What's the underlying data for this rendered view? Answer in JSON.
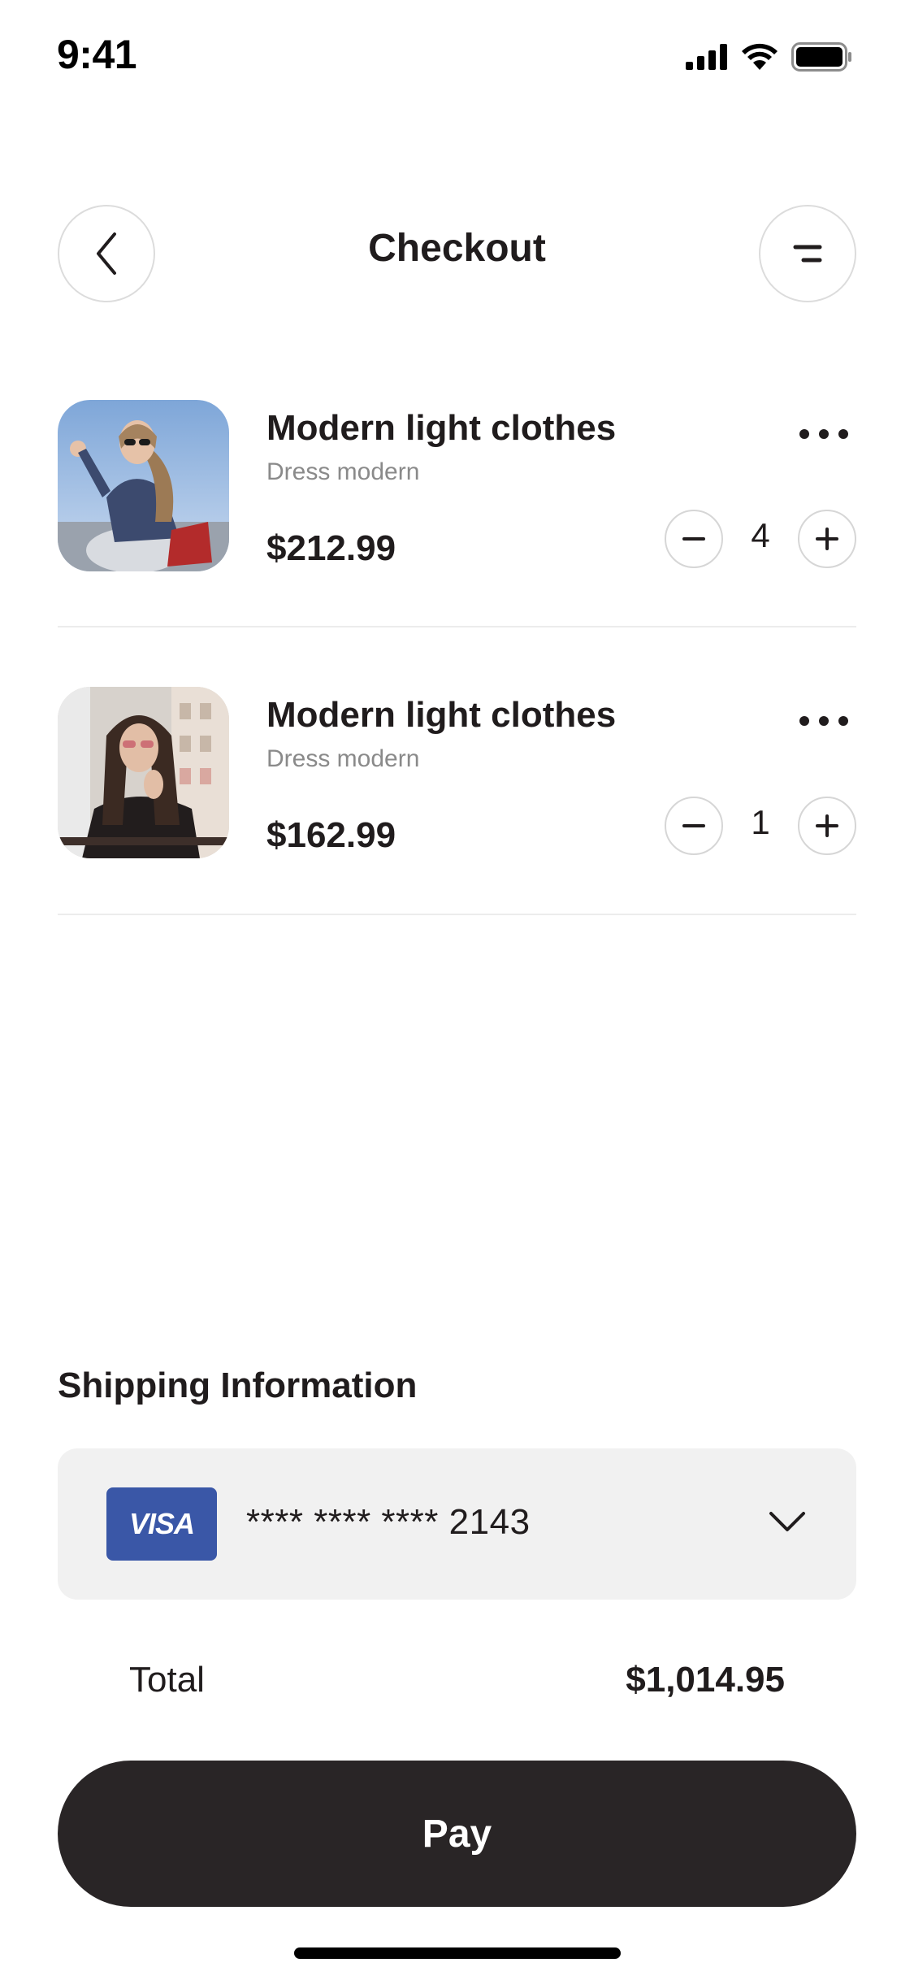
{
  "status_bar": {
    "time": "9:41",
    "icons": [
      "signal-icon",
      "wifi-icon",
      "battery-icon"
    ]
  },
  "header": {
    "title": "Checkout",
    "back_icon": "chevron-left-icon",
    "menu_icon": "menu-lines-icon"
  },
  "cart": {
    "items": [
      {
        "name": "Modern light clothes",
        "subtitle": "Dress modern",
        "price": "$212.99",
        "quantity": "4",
        "photo": "woman-sunglasses-blue-sky"
      },
      {
        "name": "Modern light clothes",
        "subtitle": "Dress modern",
        "price": "$162.99",
        "quantity": "1",
        "photo": "woman-dark-jacket-city"
      }
    ]
  },
  "shipping": {
    "title": "Shipping Information",
    "card_brand": "VISA",
    "card_number": "**** **** **** 2143"
  },
  "total": {
    "label": "Total",
    "value": "$1,014.95"
  },
  "pay_button": {
    "label": "Pay"
  },
  "colors": {
    "text": "#201c1d",
    "muted": "#8a8a8a",
    "pay_button": "#292526",
    "visa": "#3a57a7",
    "card_bg": "#f1f1f1"
  }
}
